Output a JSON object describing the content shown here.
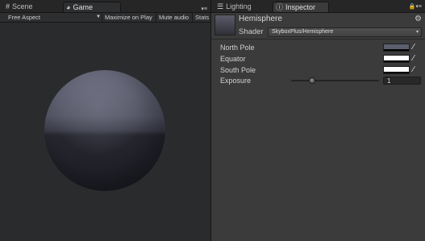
{
  "left_panel": {
    "tabs": [
      {
        "label": "Scene",
        "icon": "scene-grid-icon"
      },
      {
        "label": "Game",
        "icon": "game-pacman-icon"
      }
    ],
    "toolbar": {
      "aspect": "Free Aspect",
      "maximize": "Maximize on Play",
      "mute": "Mute audio",
      "stats": "Stats"
    }
  },
  "right_panel": {
    "tabs": [
      {
        "label": "Lighting",
        "icon": "lighting-list-icon"
      },
      {
        "label": "Inspector",
        "icon": "info-icon"
      }
    ],
    "material": {
      "name": "Hemisphere",
      "shader_label": "Shader",
      "shader_value": "SkyboxPlus/Hemisphere"
    },
    "properties": [
      {
        "label": "North Pole",
        "color": "#5b5f6e"
      },
      {
        "label": "Equator",
        "color": "#ffffff"
      },
      {
        "label": "South Pole",
        "color": "#ffffff"
      }
    ],
    "exposure": {
      "label": "Exposure",
      "value": "1",
      "slider_fraction": 0.27
    }
  },
  "colors": {
    "panel_bg": "#3b3b3b",
    "game_bg": "#2a2b2d",
    "sphere_top": "#6b6d7f",
    "sphere_bottom": "#1d1e25"
  }
}
